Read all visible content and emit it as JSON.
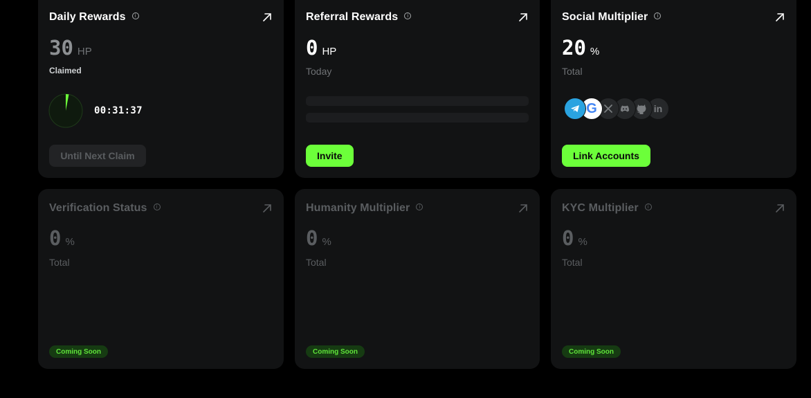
{
  "daily": {
    "title": "Daily Rewards",
    "value": "30",
    "unit": "HP",
    "status": "Claimed",
    "countdown": "00:31:37",
    "progress": 0.03,
    "button": "Until Next Claim"
  },
  "referral": {
    "title": "Referral Rewards",
    "value": "0",
    "unit": "HP",
    "period": "Today",
    "button": "Invite"
  },
  "social": {
    "title": "Social Multiplier",
    "value": "20",
    "unit": "%",
    "period": "Total",
    "button": "Link Accounts",
    "accounts": [
      "telegram-icon",
      "google-icon",
      "x-icon",
      "discord-icon",
      "github-icon",
      "linkedin-icon"
    ]
  },
  "verification": {
    "title": "Verification Status",
    "value": "0",
    "unit": "%",
    "period": "Total",
    "badge": "Coming Soon"
  },
  "humanity": {
    "title": "Humanity Multiplier",
    "value": "0",
    "unit": "%",
    "period": "Total",
    "badge": "Coming Soon"
  },
  "kyc": {
    "title": "KYC Multiplier",
    "value": "0",
    "unit": "%",
    "period": "Total",
    "badge": "Coming Soon"
  },
  "colors": {
    "accent": "#6cff3a",
    "card": "#121314",
    "badge_bg": "#163b12"
  }
}
